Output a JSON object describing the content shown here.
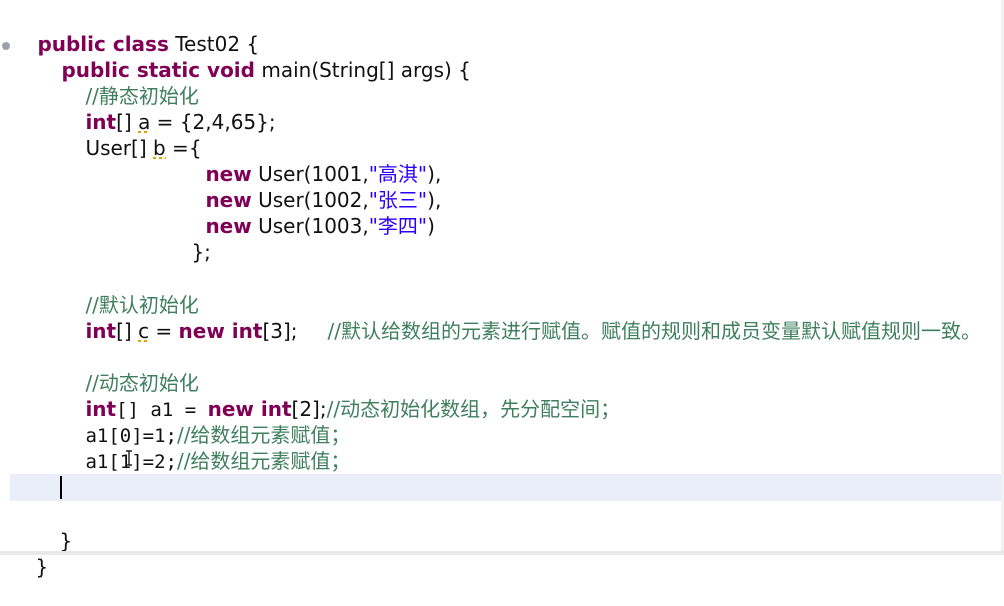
{
  "code": {
    "class_kw": "public class",
    "class_name": " Test02 {",
    "main_kw": "public static void",
    "main_rest": " main(String[] args) {",
    "c1": "//静态初始化",
    "l_a_kw": "int",
    "l_a_b": "[] ",
    "l_a_var": "a",
    "l_a_rest": " = {2,4,65};",
    "l_b_type": "User[] ",
    "l_b_var": "b",
    "l_b_rest": " ={",
    "new_kw": "new",
    "u1_pre": " User(1001,",
    "u1_str": "\"高淇\"",
    "u1_post": "),",
    "u2_pre": " User(1002,",
    "u2_str": "\"张三\"",
    "u2_post": "),",
    "u3_pre": " User(1003,",
    "u3_str": "\"李四\"",
    "u3_post": ")",
    "close_arr": "};",
    "c2": "//默认初始化",
    "l_c_kw": "int",
    "l_c_b": "[] ",
    "l_c_var": "c",
    "l_c_eq": " = ",
    "l_c_new": "new int",
    "l_c_rest": "[3];",
    "l_c_comment": "//默认给数组的元素进行赋值。赋值的规则和成员变量默认赋值规则一致。",
    "c3": "//动态初始化",
    "l_d_kw": "int",
    "l_d_mid": "[] a1 = ",
    "l_d_new": "new int",
    "l_d_rest": "[2];",
    "l_d_comment": "//动态初始化数组，先分配空间；",
    "l_e_code": "a1[0]=1;",
    "l_e_comment": "//给数组元素赋值；",
    "l_f_code": "a1[1]=2;",
    "l_f_comment": "//给数组元素赋值；",
    "close_main": "}",
    "close_class": "}"
  }
}
